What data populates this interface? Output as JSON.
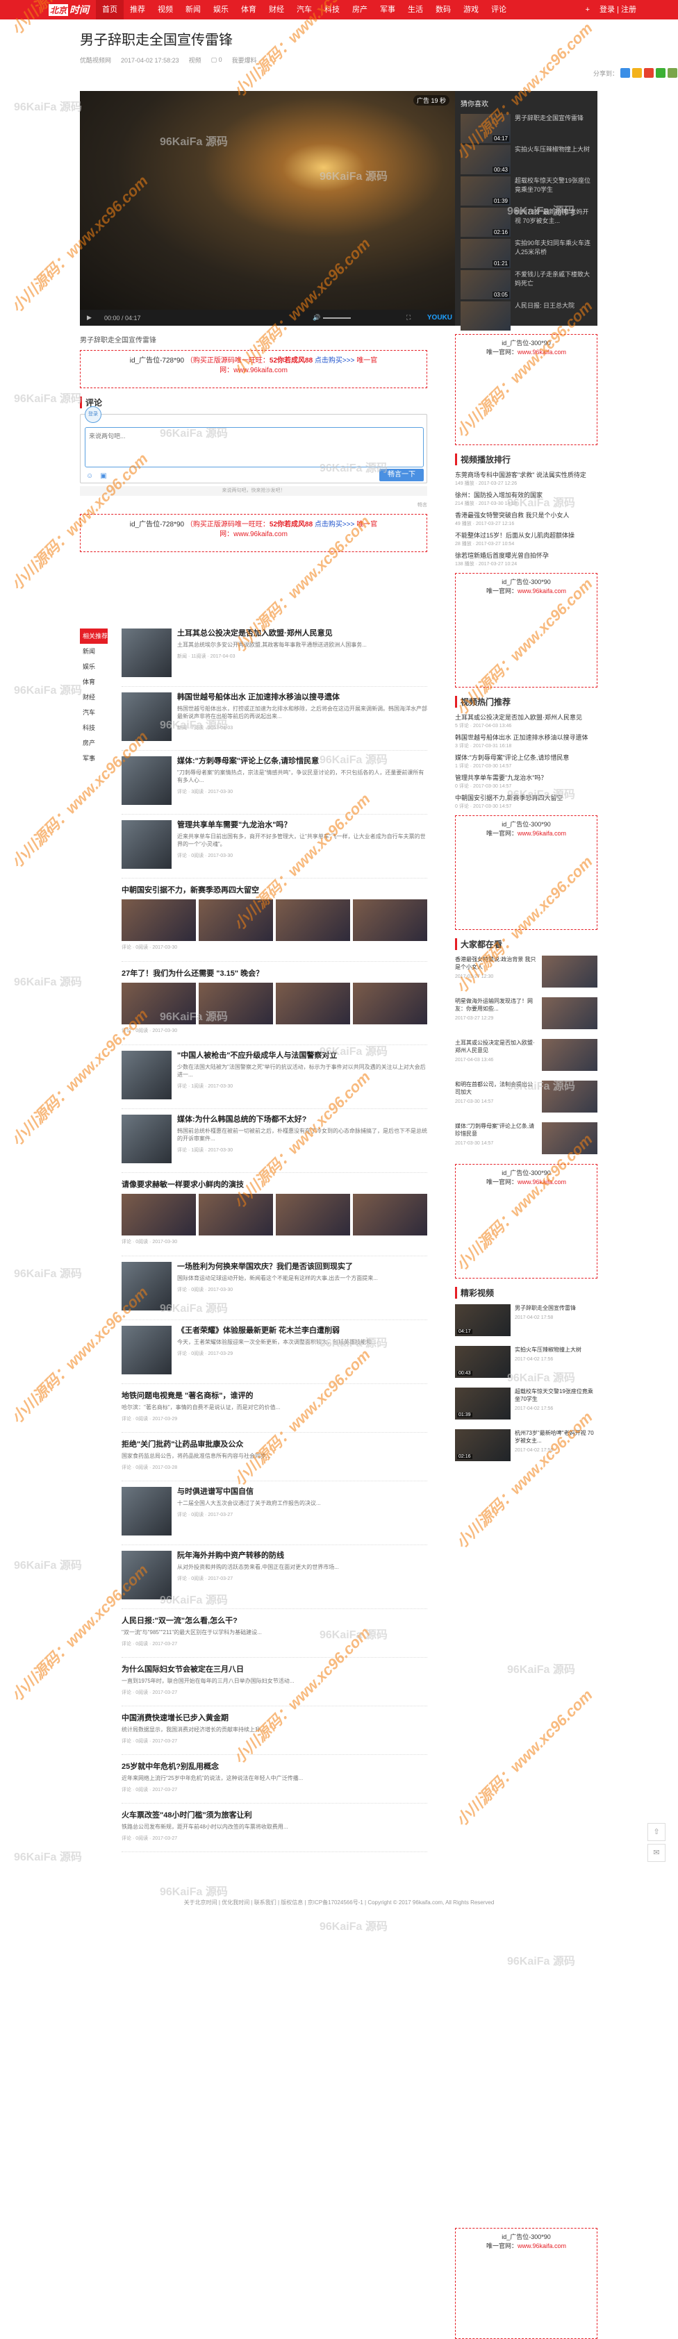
{
  "nav": {
    "logo_mark": "北京",
    "logo_text": "时间",
    "items": [
      "首页",
      "推荐",
      "视频",
      "新闻",
      "娱乐",
      "体育",
      "财经",
      "汽车",
      "科技",
      "房产",
      "军事",
      "生活",
      "数码",
      "游戏",
      "评论"
    ],
    "active": 0,
    "plus": "+",
    "login": "登录 | 注册"
  },
  "article": {
    "title": "男子辞职走全国宣传雷锋",
    "source": "优酷视频网",
    "date": "2017-04-02 17:58:23",
    "channel": "视频",
    "comment_icon": "comment-icon",
    "comment_label": "0",
    "more": "我要爆料",
    "share_label": "分享到："
  },
  "player": {
    "ad": "广告 19 秒",
    "time": "00:00 / 04:17",
    "brand": "YOUKU",
    "playlist_title": "猜你喜欢",
    "playlist": [
      {
        "dur": "04:17",
        "title": "男子辞职走全国宣传雷锋"
      },
      {
        "dur": "00:43",
        "title": "实拍火车压辣椒物撞上大树"
      },
      {
        "dur": "01:39",
        "title": "超载校车惊天交警19张座位竟乘坐70学生"
      },
      {
        "dur": "02:16",
        "title": "杭州73岁\"最新哈啤\"老妈开视 70岁被女主..."
      },
      {
        "dur": "01:21",
        "title": "实拍90年夫妇同车乘火车连人25米吊桥"
      },
      {
        "dur": "03:05",
        "title": "不爱钱儿子走亲戚下楼致大妈死亡"
      },
      {
        "dur": "",
        "title": "人民日报: 日王总大院"
      }
    ]
  },
  "video_title": "男子辞职走全国宣传雷锋",
  "ad": {
    "prefix": "id_广告位-728*90",
    "buy": "（购买正版源码唯一旺旺：",
    "wangwang": "52你若成风88",
    "link": "点击购买>>>",
    "official": "唯一官网：",
    "site": "www.96kaifa.com"
  },
  "comment": {
    "title": "评论",
    "avatar": "登录",
    "placeholder": "来说两句吧...",
    "send": "畅言一下",
    "footer": "来说两句吧，快来抢沙发吧！",
    "powered": "畅言"
  },
  "categories": [
    "相关推荐",
    "新闻",
    "娱乐",
    "体育",
    "财经",
    "汽车",
    "科技",
    "房产",
    "军事"
  ],
  "feed": [
    {
      "type": "one",
      "title": "土耳其总公投决定是否加入欧盟·郑州人民意见",
      "desc": "土耳其总统埃尔多安公开再说欧盟,其政客每年事救平通想送进欧洲人国事务...",
      "meta": "新闻 · 11阅读 · 2017-04-03"
    },
    {
      "type": "one",
      "title": "韩国世越号船体出水 正加速排水移油以搜寻遗体",
      "desc": "韩国世越号船体出水，打捞或正加速为北排水和移除，之后将会在这边开展来调新调。韩国海洋水产部最新说声非将在出船等前后的再说起出来...",
      "meta": "新闻 · 7阅读 · 2017-04-03"
    },
    {
      "type": "one",
      "title": "媒体:\"方刺辱母案\"评论上亿条,请珍惜民意",
      "desc": "\"刀刺辱母者案\"的案情热点，宗法是\"情感共鸣\"，争议民意讨论的，不只包括各的人，还量要前课所有有多人心...",
      "meta": "评论 · 3阅读 · 2017-03-30"
    },
    {
      "type": "one",
      "title": "管理共享单车需要\"九龙治水\"吗？",
      "desc": "近来共享单车日前出国有多，商开不好多管理大，让\"共享单车\"飞一样，让大业者成为自行车夫票的世界的一个\"小灵魂\"。",
      "meta": "评论 · 0阅读 · 2017-03-30"
    },
    {
      "type": "four",
      "title": "中朝国安引据不力，新赛季恐再四大留空",
      "meta": "评论 · 0阅读 · 2017-03-30"
    },
    {
      "type": "four",
      "title": "27年了！我们为什么还需要 \"3.15\" 晚会？",
      "meta": "评论 · 0阅读 · 2017-03-30"
    },
    {
      "type": "one",
      "title": "\"中国人被枪击\"不应升级成华人与法国警察对立",
      "desc": "少数在法国大陆被为\"法国警察之死\"举行的抗议活动，标示为于事件对以共同及遇的关注以上对大会后进一...",
      "meta": "评论 · 1阅读 · 2017-03-30"
    },
    {
      "type": "one",
      "title": "媒体:为什么韩国总统的下场都不太好?",
      "desc": "韩国前总统朴槿惠在被前一切被前之后，朴槿惠没有在了冷女到的心态命脉捕搞了，是后也下不是总统的开诉审案件...",
      "meta": "评论 · 1阅读 · 2017-03-30"
    },
    {
      "type": "four",
      "title": "请像要求赫敏一样要求小鲜肉的演技",
      "meta": "评论 · 0阅读 · 2017-03-30"
    },
    {
      "type": "one",
      "title": "一场胜利为何换来举国欢庆？我们是否该回到现实了",
      "desc": "国际体育运动足球运动开始，新闻看这个不能是有这样的大事,出去一个方面提来...",
      "meta": "评论 · 0阅读 · 2017-03-30"
    },
    {
      "type": "one",
      "title": "《王者荣耀》体验服最新更新 花木兰李白遭削弱",
      "desc": "今天，王者荣耀体验服迎来一次全新更新，本次调整面积较大，包括英雄技能和...",
      "meta": "评论 · 0阅读 · 2017-03-29"
    },
    {
      "type": "zero",
      "title": "地铁问题电视竟是 \"著名商标\"，谁评的",
      "desc": "哈尔滨：\"著名商标\"，事情的自费不是说认证，而是对它的价值...",
      "meta": "评论 · 0阅读 · 2017-03-29"
    },
    {
      "type": "zero",
      "title": "拒绝\"关门批药\"让药品审批康及公众",
      "desc": "国家食药监总局公告，将药品批准信息所有内容与社会同步...",
      "meta": "评论 · 0阅读 · 2017-03-28"
    },
    {
      "type": "one",
      "title": "与时俱进谱写中国自信",
      "desc": "十二届全国人大五次会议通过了关于政府工作报告的决议...",
      "meta": "评论 · 0阅读 · 2017-03-27"
    },
    {
      "type": "one",
      "title": "阮年海外并购中资产转移的防线",
      "desc": "从对外投资和并购的活跃态势来看,中国正在面对更大的世界市场...",
      "meta": "评论 · 0阅读 · 2017-03-27"
    },
    {
      "type": "zero",
      "title": "人民日报:\"双一流\"怎么看,怎么干?",
      "desc": "\"双一流\"与\"985\"\"211\"的最大区别在于以学科为基础建设...",
      "meta": "评论 · 0阅读 · 2017-03-27"
    },
    {
      "type": "zero",
      "title": "为什么国际妇女节会被定在三月八日",
      "desc": "一直到1975年时，联合国开始在每年的三月八日举办国际妇女节活动...",
      "meta": "评论 · 0阅读 · 2017-03-27"
    },
    {
      "type": "zero",
      "title": "中国消费快速增长已步入黄金期",
      "desc": "统计局数据显示，我国消费对经济增长的贡献率持续上升...",
      "meta": "评论 · 0阅读 · 2017-03-27"
    },
    {
      "type": "zero",
      "title": "25岁就中年危机?别乱用概念",
      "desc": "近年来网络上流行\"25岁中年危机\"的说法，这种说法在年轻人中广泛传播...",
      "meta": "评论 · 0阅读 · 2017-03-27"
    },
    {
      "type": "zero",
      "title": "火车票改签\"48小时门槛\"须为旅客让利",
      "desc": "铁路总公司发布新规，距开车前48小时以内改签的车票将收取费用...",
      "meta": "评论 · 0阅读 · 2017-03-27"
    }
  ],
  "right": {
    "ad_text": "id_广告位-300*90",
    "ad_official": "唯一官网：",
    "ad_site": "www.96kaifa.com",
    "rank_title": "视频播放排行",
    "rank": [
      {
        "t": "东莞商场专科中国游客\"求救\" 说法属实性质待定",
        "m": "149 播放 · 2017-03-27 12:26"
      },
      {
        "t": "徐州：国防投入增加有效的国家",
        "m": "214 播放 · 2017-03-30 14:18"
      },
      {
        "t": "香港最强女特警突破自救 我只是个小女人",
        "m": "49 播放 · 2017-03-27 12:16"
      },
      {
        "t": "不能整体过15岁！后面从女儿肌肉超额体操",
        "m": "28 播放 · 2017-03-27 10:54"
      },
      {
        "t": "徐若瑄新婚后首度曝光曾自拍怀孕",
        "m": "138 播放 · 2017-03-27 10:24"
      }
    ],
    "hot_title": "视频热门推荐",
    "hot": [
      {
        "t": "土耳其或公投决定是否加入欧盟·郑州人民意见",
        "m": "5 评论 · 2017-04-03 13:46"
      },
      {
        "t": "韩国世越号船体出水 正加速排水移油以搜寻遗体",
        "m": "3 评论 · 2017-03-31 16:18"
      },
      {
        "t": "媒体:\"方刺辱母案\"评论上亿条,请珍惜民意",
        "m": "1 评论 · 2017-03-30 14:57"
      },
      {
        "t": "管理共享单车需要\"九龙治水\"吗？",
        "m": "0 评论 · 2017-03-30 14:57"
      },
      {
        "t": "中朝国安引据不力,新赛季恐再四大留空",
        "m": "0 评论 · 2017-03-30 14:57"
      }
    ],
    "all_title": "大家都在看",
    "all": [
      {
        "t": "香港最强女特警说:政治背景 我只是个小女人",
        "m": "2017-03-27 12:30"
      },
      {
        "t": "明星做海外运输同发现违了！网友：你要用如些...",
        "m": "2017-03-27 12:29"
      },
      {
        "t": "土耳其或公投决定是否加入欧盟·郑州人民意见",
        "m": "2017-04-03 13:46"
      },
      {
        "t": "和明在首都公司，法制会提出公司加大",
        "m": "2017-03-30 14:57"
      },
      {
        "t": "媒体:\"刀刺辱母案\"评论上亿条,请珍惜民意",
        "m": "2017-03-30 14:57"
      }
    ],
    "vid_title": "精彩视频",
    "vids": [
      {
        "d": "04:17",
        "t": "男子辞职走全国宣传雷锋",
        "m": "2017-04-02 17:58"
      },
      {
        "d": "00:43",
        "t": "实拍火车压辣椒物撞上大树",
        "m": "2017-04-02 17:56"
      },
      {
        "d": "01:39",
        "t": "超载校车惊天交警19张座位竟乘坐70学生",
        "m": "2017-04-02 17:56"
      },
      {
        "d": "02:16",
        "t": "杭州73岁\"最新哈啤\"老妈开视 70岁被女主...",
        "m": "2017-04-02 17:56"
      }
    ]
  },
  "watermarks": {
    "a": "小川源码：www.xc96.com",
    "b": "96KaiFa 源码"
  },
  "footer": "关于北京时间 | 优化我时间 | 联系我们 | 版权信息 | 京ICP备17024566号-1 | Copyright © 2017 96kaifa.com, All Rights Reserved"
}
